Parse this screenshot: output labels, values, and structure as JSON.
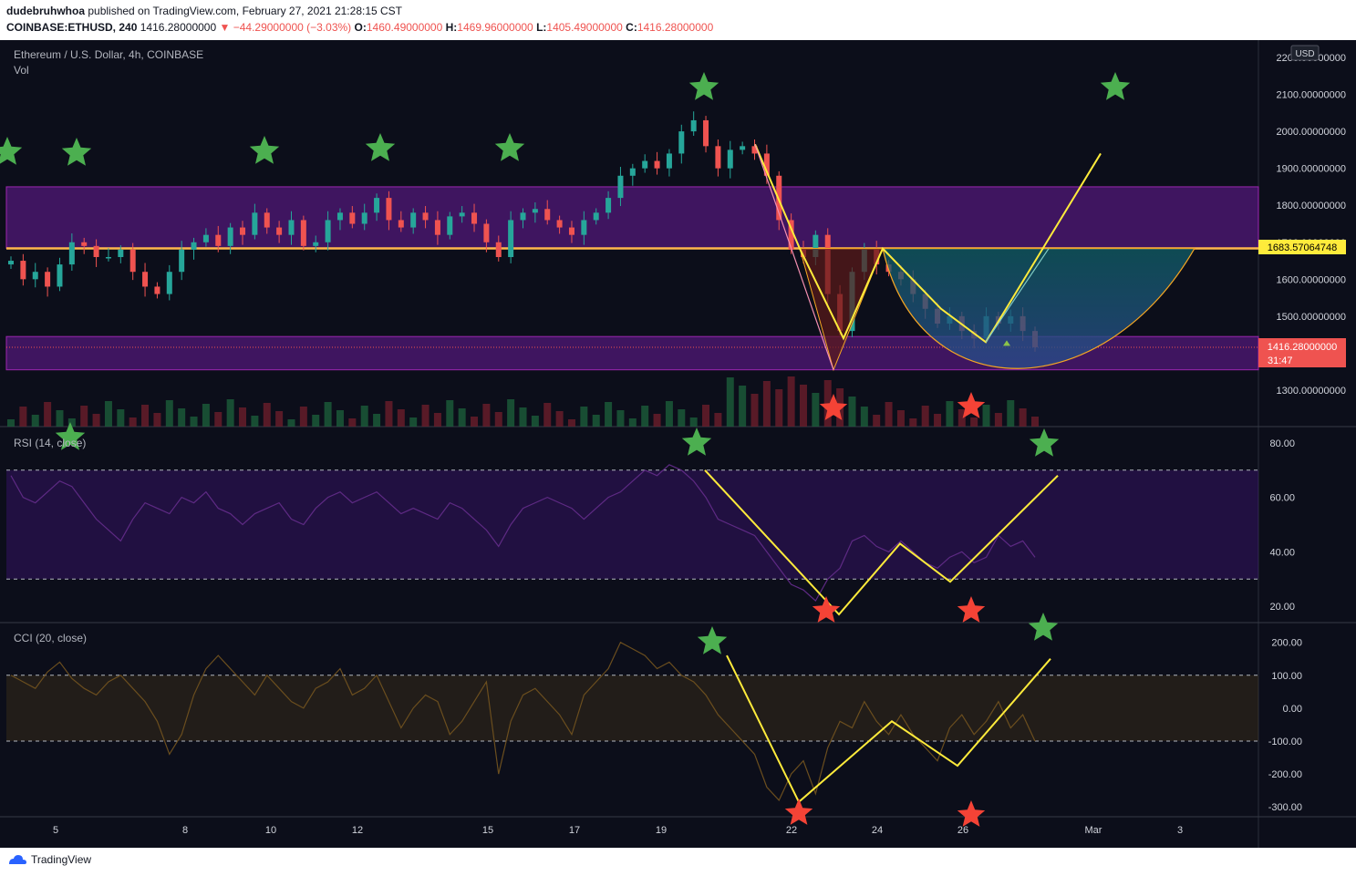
{
  "header": {
    "author": "dudebruhwhoa",
    "published": "published on TradingView.com, February 27, 2021 21:28:15 CST",
    "symbol": "COINBASE:ETHUSD, 240",
    "last": "1416.28000000",
    "change": "−44.29000000 (−3.03%)",
    "o_label": "O:",
    "o": "1460.49000000",
    "h_label": "H:",
    "h": "1469.96000000",
    "l_label": "L:",
    "l": "1405.49000000",
    "c_label": "C:",
    "c": "1416.28000000"
  },
  "legend": {
    "title": "Ethereum / U.S. Dollar, 4h, COINBASE",
    "vol": "Vol",
    "rsi": "RSI (14, close)",
    "cci": "CCI (20, close)"
  },
  "currency": "USD",
  "price_marker": "1683.57064748",
  "last_marker": "1416.28000000",
  "countdown": "31:47",
  "footer": {
    "brand": "TradingView"
  },
  "colors": {
    "background": "#0c0e1a",
    "up": "#26a69a",
    "down": "#ef5350",
    "zone": "#6a1b9a",
    "level": "#ffeb3b",
    "star_green": "#4caf50",
    "star_red": "#f44336"
  },
  "chart_data": [
    {
      "type": "candlestick",
      "title": "Ethereum / U.S. Dollar, 4h, COINBASE",
      "x_ticks": [
        "5",
        "8",
        "10",
        "12",
        "15",
        "17",
        "19",
        "22",
        "24",
        "26",
        "Mar",
        "3"
      ],
      "y_ticks": [
        "2200.00000000",
        "2100.00000000",
        "2000.00000000",
        "1900.00000000",
        "1800.00000000",
        "1700.00000000",
        "1600.00000000",
        "1500.00000000",
        "1400.00000000",
        "1300.00000000"
      ],
      "ylim": [
        1200,
        2225
      ],
      "resistance_level": 1683.57064748,
      "zones": [
        [
          1683.57,
          1850
        ],
        [
          1355,
          1445
        ]
      ],
      "close_path": [
        1650,
        1600,
        1620,
        1580,
        1640,
        1700,
        1690,
        1660,
        1660,
        1680,
        1620,
        1580,
        1560,
        1620,
        1680,
        1700,
        1720,
        1690,
        1740,
        1720,
        1780,
        1740,
        1720,
        1760,
        1690,
        1700,
        1760,
        1780,
        1750,
        1780,
        1820,
        1760,
        1740,
        1780,
        1760,
        1720,
        1770,
        1780,
        1750,
        1700,
        1660,
        1760,
        1780,
        1790,
        1760,
        1740,
        1720,
        1760,
        1780,
        1820,
        1880,
        1900,
        1920,
        1900,
        1940,
        2000,
        2030,
        1960,
        1900,
        1950,
        1960,
        1940,
        1880,
        1760,
        1680,
        1660,
        1720,
        1560,
        1460,
        1620,
        1680,
        1640,
        1620,
        1600,
        1560,
        1520,
        1480,
        1500,
        1460,
        1440,
        1500,
        1480,
        1500,
        1460,
        1416
      ],
      "projection": [
        [
          1430,
          1940
        ]
      ],
      "cup": {
        "left": 1683.57,
        "bottom": 1355,
        "right": 1683.57
      }
    },
    {
      "type": "line",
      "title": "RSI (14, close)",
      "y_ticks": [
        "80.00",
        "60.00",
        "40.00",
        "20.00"
      ],
      "ylim": [
        14,
        86
      ],
      "bands": [
        30,
        70
      ],
      "values": [
        68,
        60,
        58,
        62,
        66,
        64,
        58,
        52,
        48,
        44,
        52,
        58,
        56,
        54,
        60,
        58,
        62,
        56,
        54,
        50,
        54,
        56,
        58,
        52,
        50,
        56,
        60,
        62,
        58,
        60,
        62,
        58,
        54,
        56,
        54,
        52,
        58,
        56,
        52,
        48,
        42,
        50,
        56,
        58,
        60,
        58,
        56,
        52,
        56,
        60,
        62,
        66,
        70,
        68,
        72,
        70,
        66,
        60,
        52,
        50,
        48,
        46,
        40,
        34,
        28,
        26,
        22,
        30,
        34,
        44,
        46,
        42,
        40,
        44,
        40,
        36,
        34,
        38,
        40,
        36,
        38,
        46,
        42,
        44,
        38
      ]
    },
    {
      "type": "line",
      "title": "CCI (20, close)",
      "y_ticks": [
        "200.00",
        "100.00",
        "0.00",
        "-100.00",
        "-200.00",
        "-300.00"
      ],
      "ylim": [
        -330,
        260
      ],
      "bands": [
        -100,
        100
      ],
      "values": [
        100,
        80,
        60,
        110,
        140,
        90,
        60,
        40,
        80,
        100,
        60,
        20,
        -40,
        -140,
        -80,
        40,
        120,
        160,
        120,
        80,
        40,
        100,
        60,
        20,
        0,
        60,
        80,
        120,
        40,
        60,
        100,
        20,
        -60,
        0,
        40,
        20,
        -80,
        -40,
        20,
        80,
        -200,
        -40,
        40,
        60,
        20,
        -20,
        -80,
        40,
        80,
        120,
        200,
        180,
        160,
        120,
        140,
        100,
        80,
        40,
        -20,
        -60,
        -100,
        -140,
        -240,
        -280,
        -200,
        -160,
        -260,
        -120,
        -40,
        -60,
        20,
        -40,
        -80,
        -20,
        -80,
        -120,
        -160,
        -60,
        -20,
        -80,
        -40,
        20,
        -60,
        -20,
        -100
      ]
    }
  ]
}
